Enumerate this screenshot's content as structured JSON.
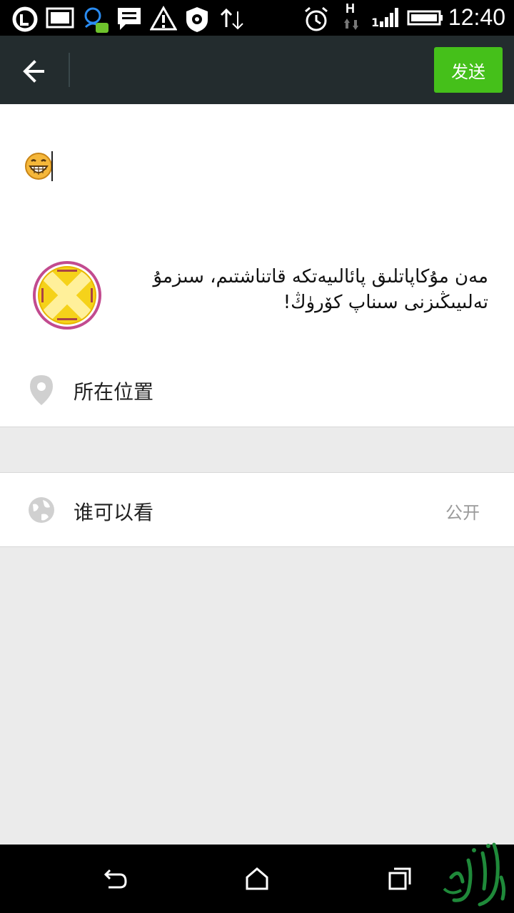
{
  "status_bar": {
    "time": "12:40",
    "network_type": "H",
    "sim_slot": "1",
    "icons": [
      "sync-icon",
      "gallery-icon",
      "qq-icon",
      "message-icon",
      "warning-icon",
      "settings-shield-icon",
      "data-transfer-icon",
      "alarm-icon",
      "network-h-icon",
      "signal-icon",
      "battery-icon"
    ]
  },
  "app_bar": {
    "back_icon": "back-arrow-icon",
    "send_label": "发送",
    "send_color": "#45c01a"
  },
  "compose": {
    "emoji": "grinning-face-icon",
    "share_text": "مەن مۇكاپاتلىق پائالىيەتكە قاتناشتىم، سىزمۇ تەلىيىڭىزنى سىناپ كۆرۈڭ!"
  },
  "location": {
    "icon": "location-pin-icon",
    "label": "所在位置"
  },
  "visibility": {
    "icon": "globe-icon",
    "label": "谁可以看",
    "value": "公开"
  },
  "nav_bar": {
    "buttons": [
      "back-icon",
      "home-icon",
      "recents-icon"
    ]
  }
}
